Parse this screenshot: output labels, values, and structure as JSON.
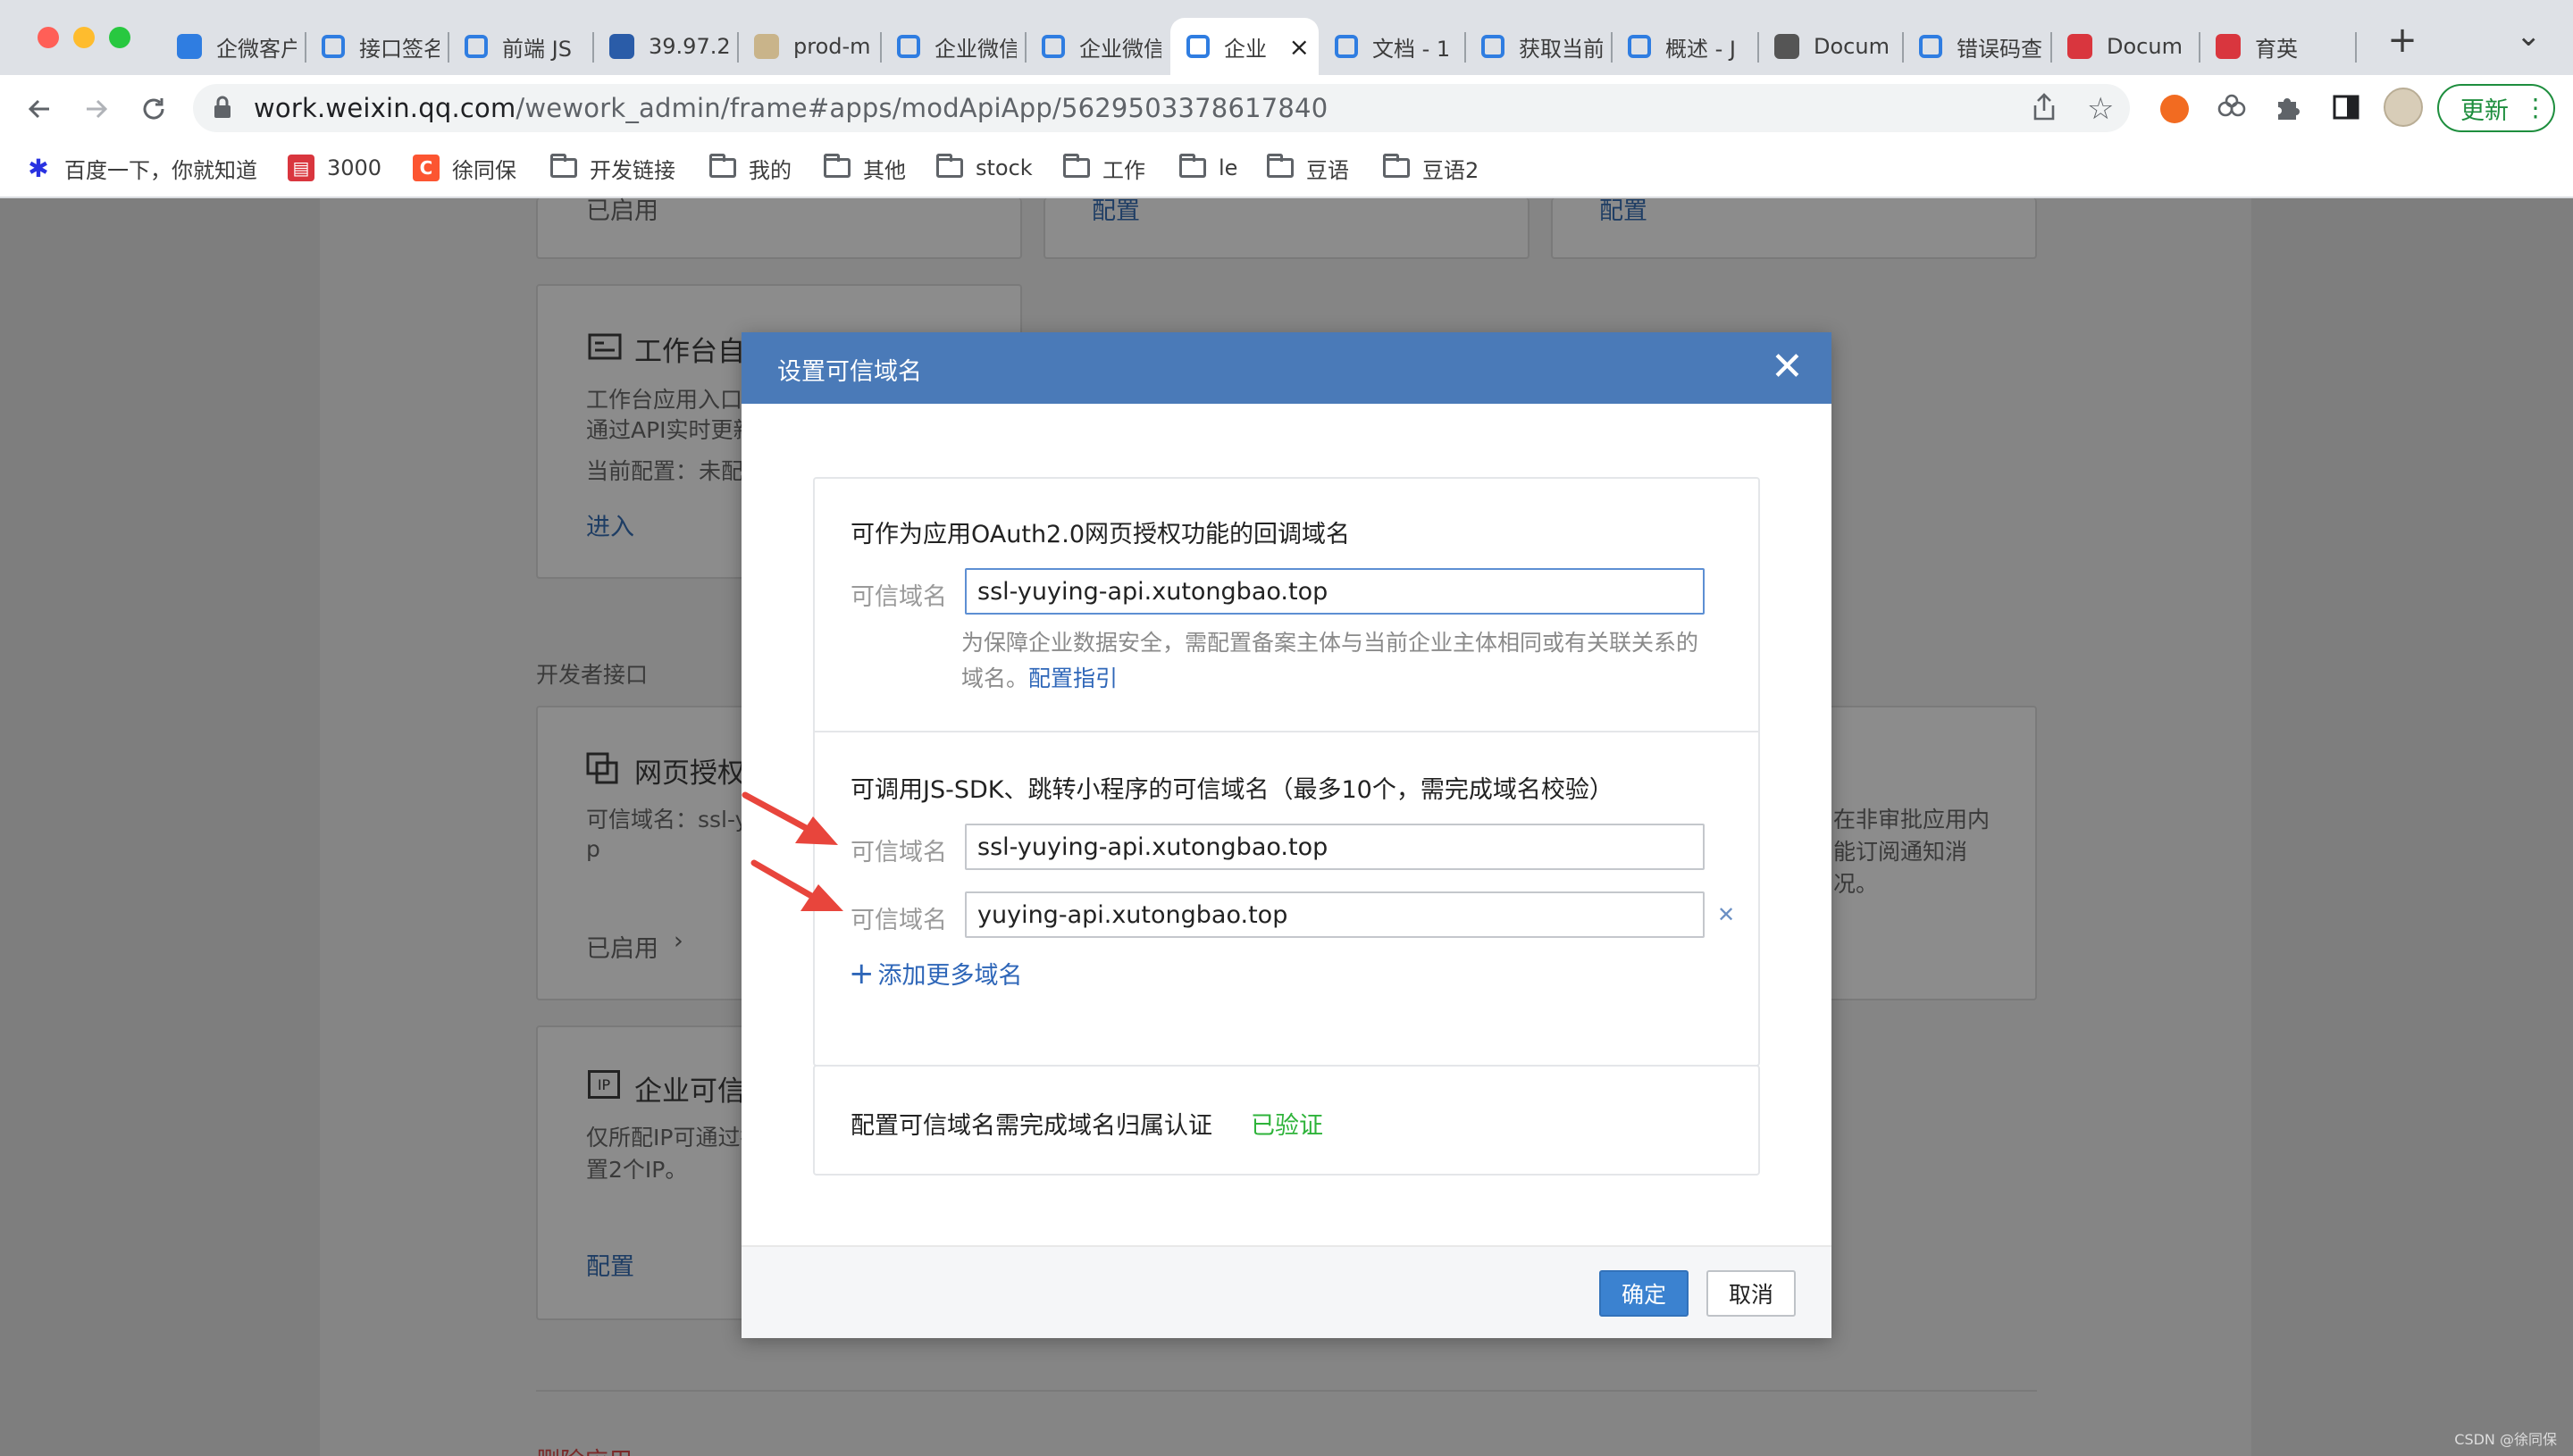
{
  "browser": {
    "tabs": [
      {
        "label": "企微客户",
        "icon": "square-app-icon",
        "fav_color": "#2f7de1"
      },
      {
        "label": "接口签名",
        "icon": "wechat-work-icon"
      },
      {
        "label": "前端 JS",
        "icon": "wechat-work-icon"
      },
      {
        "label": "39.97.2",
        "icon": "server-icon",
        "fav_color": "#2a5ca8"
      },
      {
        "label": "prod-m",
        "icon": "avatar-icon",
        "fav_color": "#c9b48a"
      },
      {
        "label": "企业微信",
        "icon": "wechat-work-icon"
      },
      {
        "label": "企业微信",
        "icon": "wechat-work-icon"
      },
      {
        "label": "企业",
        "icon": "wechat-work-icon",
        "active": true
      },
      {
        "label": "文档 - 1",
        "icon": "wechat-work-icon"
      },
      {
        "label": "获取当前",
        "icon": "wechat-work-icon"
      },
      {
        "label": "概述 - J",
        "icon": "wechat-work-icon"
      },
      {
        "label": "Docum",
        "icon": "globe-icon",
        "fav_color": "#555555"
      },
      {
        "label": "错误码查",
        "icon": "wechat-work-icon"
      },
      {
        "label": "Docum",
        "icon": "book-icon",
        "fav_color": "#d9363e"
      },
      {
        "label": "育英",
        "icon": "book-icon",
        "fav_color": "#d9363e"
      }
    ],
    "new_tab_glyph": "+",
    "tab_menu_glyph": "⌄",
    "url": {
      "host": "work.weixin.qq.com",
      "path": "/wework_admin/frame#apps/modApiApp/5629503378617840"
    },
    "update_label": "更新",
    "bookmarks": [
      {
        "label": "百度一下，你就知道",
        "icon": "baidu-paw-icon"
      },
      {
        "label": "3000",
        "icon": "book-icon"
      },
      {
        "label": "徐同保",
        "icon": "csdn-c-icon"
      },
      {
        "label": "开发链接",
        "icon": "folder-icon"
      },
      {
        "label": "我的",
        "icon": "folder-icon"
      },
      {
        "label": "其他",
        "icon": "folder-icon"
      },
      {
        "label": "stock",
        "icon": "folder-icon"
      },
      {
        "label": "工作",
        "icon": "folder-icon"
      },
      {
        "label": "le",
        "icon": "folder-icon"
      },
      {
        "label": "豆语",
        "icon": "folder-icon"
      },
      {
        "label": "豆语2",
        "icon": "folder-icon"
      }
    ]
  },
  "background": {
    "top_status": "已启用",
    "top_config_1": "配置",
    "top_config_2": "配置",
    "workbench_title": "工作台自",
    "workbench_desc_1": "工作台应用入口应",
    "workbench_desc_2": "通过API实时更新",
    "workbench_current": "当前配置：",
    "workbench_current_val": "未配",
    "workbench_enter": "进入",
    "dev_section": "开发者接口",
    "oauth_title": "网页授权",
    "oauth_desc_1": "可信域名：ssl-y",
    "oauth_desc_2": "p",
    "oauth_status": "已启用",
    "right_desc_1": "在非审批应用内",
    "right_desc_2": "能订阅通知消",
    "right_desc_3": "况。",
    "ip_title": "企业可信",
    "ip_desc_1": "仅所配IP可通过接",
    "ip_desc_2": "置2个IP。",
    "ip_config": "配置",
    "bottom_link": "删除应用"
  },
  "modal": {
    "title": "设置可信域名",
    "close_glyph": "✕",
    "oauth": {
      "title": "可作为应用OAuth2.0网页授权功能的回调域名",
      "label": "可信域名",
      "value": "ssl-yuying-api.xutongbao.top",
      "hint": "为保障企业数据安全，需配置备案主体与当前企业主体相同或有关联关系的域名。",
      "hint_link": "配置指引"
    },
    "jssdk": {
      "title": "可调用JS-SDK、跳转小程序的可信域名（最多10个，需完成域名校验）",
      "label": "可信域名",
      "values": [
        "ssl-yuying-api.xutongbao.top",
        "yuying-api.xutongbao.top"
      ],
      "remove_glyph": "✕",
      "add_glyph": "+",
      "add_label": "添加更多域名"
    },
    "verify": {
      "text": "配置可信域名需完成域名归属认证",
      "status": "已验证"
    },
    "ok_label": "确定",
    "cancel_label": "取消"
  },
  "colors": {
    "modal_header": "#4a7ab8",
    "primary": "#3b82d0",
    "link": "#2e66b8",
    "verified": "#2eb33a",
    "arrow": "#e8453c"
  },
  "watermark": "CSDN @徐同保"
}
